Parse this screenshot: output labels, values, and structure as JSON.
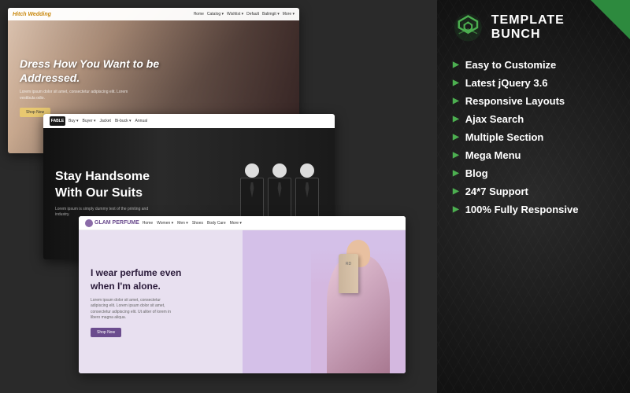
{
  "left": {
    "wedding": {
      "logo": "Hitch Wedding",
      "nav_links": [
        "Home",
        "Catalog",
        "Wishlist",
        "Default",
        "Balimgit",
        "More"
      ],
      "hero_title": "Dress How You Want to be Addressed.",
      "hero_sub": "Lorem ipsum dolor sit amet, consectetur adipiscing elit. Lorem vestibula odio.",
      "shop_btn": "Shop Now"
    },
    "suit": {
      "logo": "FABLE",
      "nav_links": [
        "Buy",
        "Buyer",
        "Jacket",
        "Bi-buck",
        "Annual"
      ],
      "hero_title": "Stay Handsome With Our Suits",
      "hero_sub": "Lorem ipsum is simply dummy text of the printing and industry."
    },
    "perfume": {
      "logo": "GLAM PERFUME",
      "nav_links": [
        "Home",
        "Women",
        "Men",
        "Shoes",
        "Body Care",
        "More"
      ],
      "hero_title": "I wear perfume even when I'm alone.",
      "hero_sub": "Lorem ipsum dolor sit amet, consectetur adipiscing elit. Lorem ipsum dolor sit amet, consectetur adipiscing elit. Ut aliter of lorem in libero magna aliqua.",
      "shop_btn": "Shop Now",
      "bottle_label": "RD"
    }
  },
  "right": {
    "brand": {
      "name": "TEMPLATE BUNCH"
    },
    "features": [
      {
        "label": "Easy to Customize"
      },
      {
        "label": "Latest jQuery 3.6"
      },
      {
        "label": "Responsive Layouts"
      },
      {
        "label": "Ajax Search"
      },
      {
        "label": "Multiple Section"
      },
      {
        "label": "Mega Menu"
      },
      {
        "label": "Blog"
      },
      {
        "label": "24*7 Support"
      },
      {
        "label": "100% Fully Responsive"
      }
    ]
  }
}
